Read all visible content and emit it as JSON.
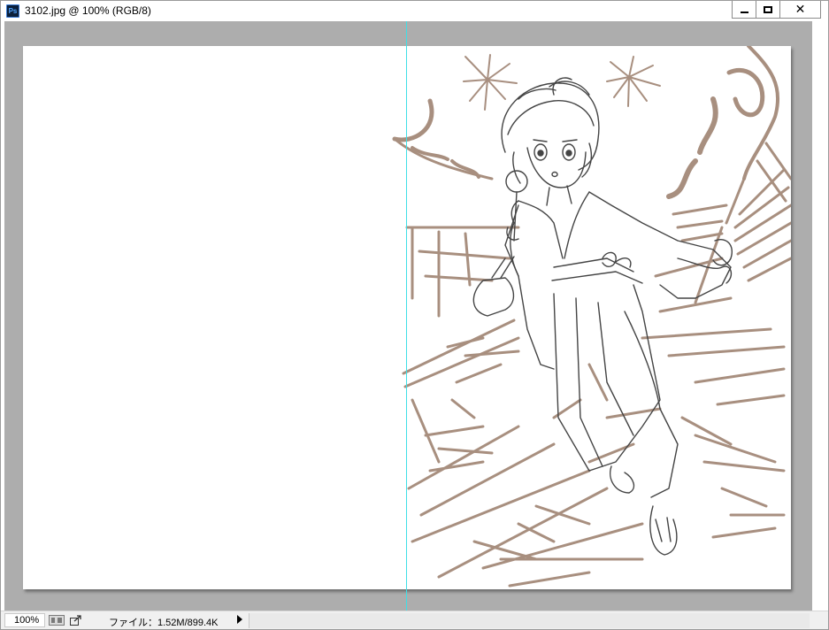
{
  "window": {
    "title": "3102.jpg @ 100% (RGB/8)",
    "app_icon_label": "Ps",
    "controls": {
      "minimize_icon": "minimize-icon",
      "maximize_icon": "maximize-icon",
      "close_glyph": "✕"
    }
  },
  "canvas": {
    "background_color": "#adadad",
    "document_color": "#ffffff",
    "guide_color": "#3fdfe6",
    "sketch_line_color": "#444444",
    "background_sketch_color": "#8b6a55"
  },
  "statusbar": {
    "zoom": "100%",
    "file_info": "ファイル：1.52M/899.4K",
    "icons": [
      "pixel-aspect-icon",
      "share-icon",
      "expand-arrow-icon"
    ]
  }
}
